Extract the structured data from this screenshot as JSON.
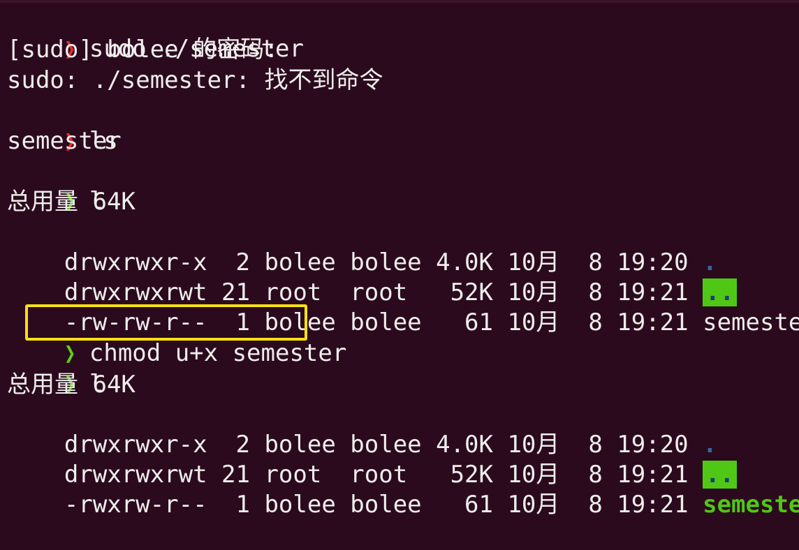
{
  "colors": {
    "background": "#2c0a1e",
    "text": "#eeeeec",
    "prompt_error": "#ef2929",
    "prompt_ok": "#5cd11a",
    "dir_blue": "#3465a4",
    "sticky_bg": "#4ec814",
    "exec_green": "#4ec814",
    "highlight_border": "#f6e016"
  },
  "prompt_symbol": "❯",
  "lines": [
    {
      "kind": "command",
      "status": "error",
      "text": "sudo ./semester"
    },
    {
      "kind": "output",
      "text": "[sudo] bolee 的密码:"
    },
    {
      "kind": "output",
      "text": "sudo: ./semester: 找不到命令"
    },
    {
      "kind": "command",
      "status": "error",
      "text": "ls"
    },
    {
      "kind": "output",
      "text": "semester"
    },
    {
      "kind": "command",
      "status": "ok",
      "text": "l"
    },
    {
      "kind": "output",
      "text": "总用量 64K"
    },
    {
      "kind": "listing",
      "text": "drwxrwxr-x  2 bolee bolee 4.0K 10月  8 19:20 ",
      "name": "."
    },
    {
      "kind": "listing",
      "text": "drwxrwxrwt 21 root  root   52K 10月  8 19:21 ",
      "name": ".."
    },
    {
      "kind": "listing",
      "text": "-rw-rw-r--  1 bolee bolee   61 10月  8 19:21 ",
      "name": "semester"
    },
    {
      "kind": "command",
      "status": "ok",
      "text": "chmod u+x semester"
    },
    {
      "kind": "command",
      "status": "ok",
      "text": "l"
    },
    {
      "kind": "output",
      "text": "总用量 64K"
    },
    {
      "kind": "listing",
      "text": "drwxrwxr-x  2 bolee bolee 4.0K 10月  8 19:20 ",
      "name": "."
    },
    {
      "kind": "listing",
      "text": "drwxrwxrwt 21 root  root   52K 10月  8 19:21 ",
      "name": ".."
    },
    {
      "kind": "listing",
      "text": "-rwxrw-r--  1 bolee bolee   61 10月  8 19:21 ",
      "name": "semester"
    }
  ]
}
